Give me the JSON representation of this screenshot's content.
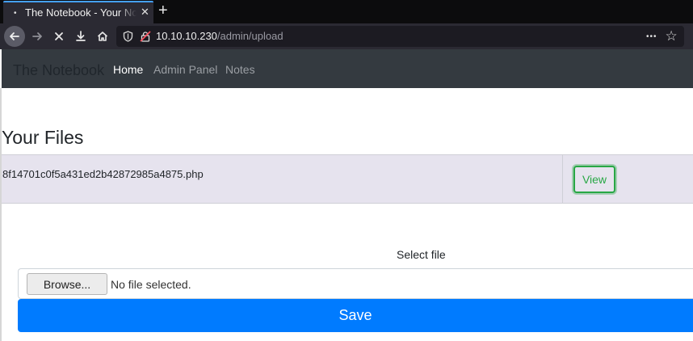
{
  "browser": {
    "tab": {
      "dot": "•",
      "title": "The Notebook - Your Notebook",
      "close": "✕"
    },
    "new_tab": "+",
    "url": {
      "host": "10.10.10.230",
      "path": "/admin/upload"
    },
    "menu_dots": "•••",
    "bookmark": "☆"
  },
  "site_nav": {
    "brand": "The Notebook",
    "links": [
      {
        "label": "Home",
        "active": true
      },
      {
        "label": "Admin Panel",
        "active": false
      },
      {
        "label": "Notes",
        "active": false
      }
    ]
  },
  "files": {
    "heading": "Your Files",
    "rows": [
      {
        "name": "8f14701c0f5a431ed2b42872985a4875.php",
        "action": "View"
      }
    ]
  },
  "upload": {
    "label": "Select file",
    "browse_label": "Browse...",
    "status": "No file selected.",
    "save_label": "Save"
  },
  "colors": {
    "accent": "#007bff",
    "success": "#28a745",
    "navbar": "#343a40"
  }
}
